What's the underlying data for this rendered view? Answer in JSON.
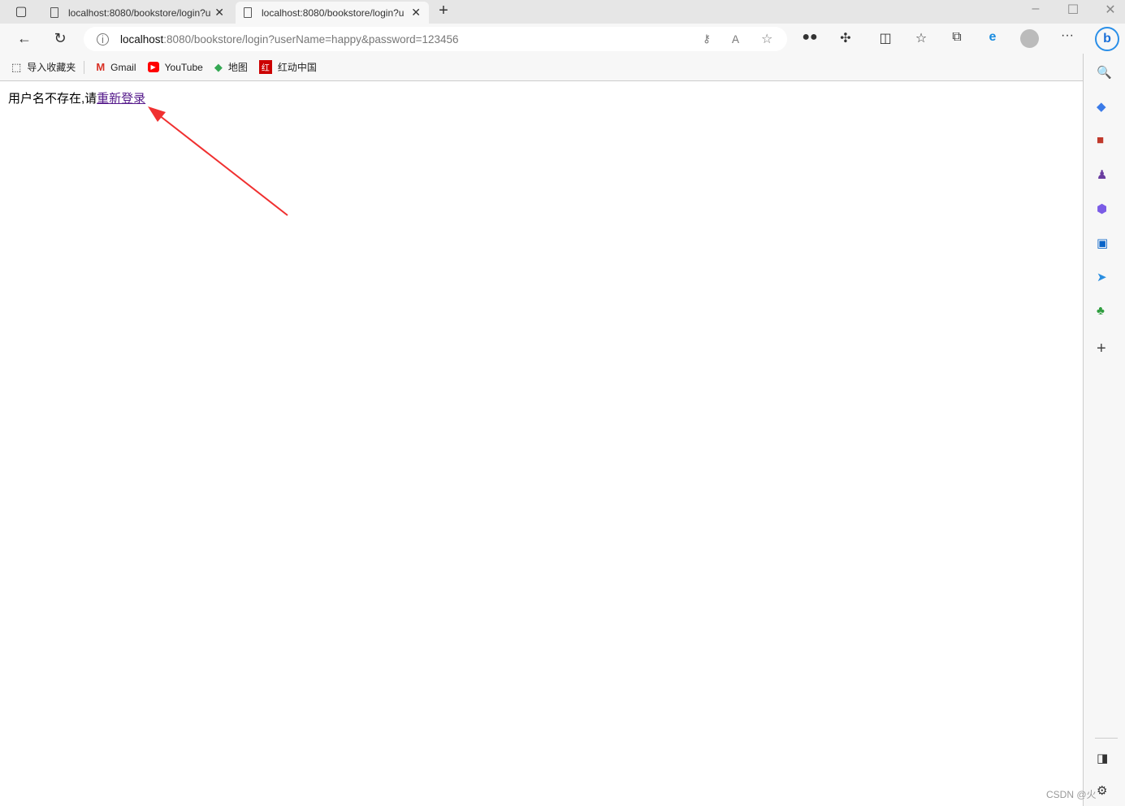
{
  "tabs": [
    {
      "title": "localhost:8080/bookstore/login?u",
      "active": false
    },
    {
      "title": "localhost:8080/bookstore/login?u",
      "active": true
    }
  ],
  "address": {
    "host": "localhost",
    "rest": ":8080/bookstore/login?userName=happy&password=123456"
  },
  "bookmarks": [
    {
      "label": "导入收藏夹",
      "icon": "import-icon"
    },
    {
      "label": "Gmail",
      "icon": "gmail-icon"
    },
    {
      "label": "YouTube",
      "icon": "youtube-icon"
    },
    {
      "label": "地图",
      "icon": "maps-icon"
    },
    {
      "label": "红动中国",
      "icon": "redocn-icon"
    }
  ],
  "page": {
    "message": "用户名不存在,请",
    "link": "重新登录"
  },
  "watermark": "CSDN @火",
  "annotation_color": "#f03030"
}
